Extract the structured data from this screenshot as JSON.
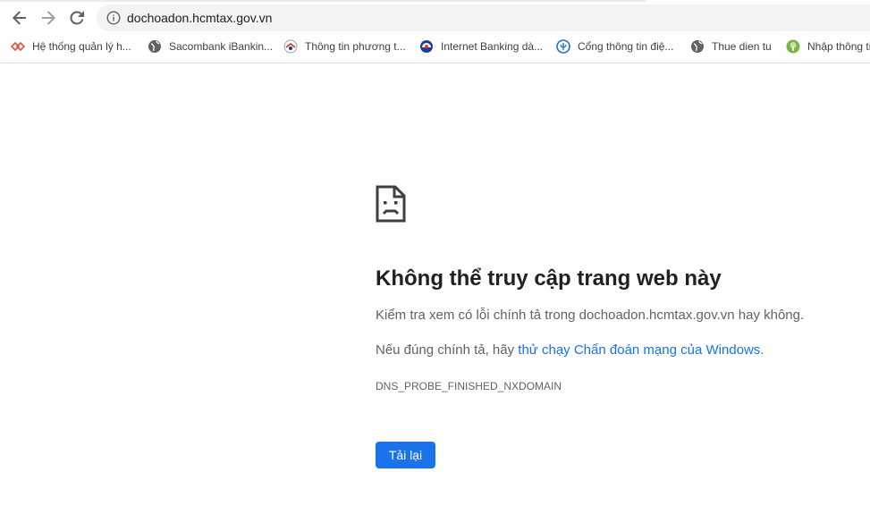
{
  "browser": {
    "url": "dochoadon.hcmtax.gov.vn",
    "bookmarks": [
      {
        "label": "Hệ thống quản lý h...",
        "icon": "red-diamond-logo-icon"
      },
      {
        "label": "Sacombank iBankin...",
        "icon": "globe-icon"
      },
      {
        "label": "Thông tin phương t...",
        "icon": "site-logo-icon"
      },
      {
        "label": "Internet Banking dà...",
        "icon": "bank-logo-icon"
      },
      {
        "label": "Cổng thông tin điệ...",
        "icon": "portal-logo-icon"
      },
      {
        "label": "Thue dien tu",
        "icon": "globe-icon"
      },
      {
        "label": "Nhập thông tin",
        "icon": "tree-logo-icon"
      }
    ]
  },
  "error": {
    "title": "Không thể truy cập trang web này",
    "line1": "Kiểm tra xem có lỗi chính tả trong dochoadon.hcmtax.gov.vn hay không.",
    "line2_prefix": "Nếu đúng chính tả, hãy ",
    "line2_link": "thử chạy Chẩn đoán mạng của Windows",
    "line2_suffix": ".",
    "code": "DNS_PROBE_FINISHED_NXDOMAIN",
    "reload_label": "Tải lại"
  },
  "colors": {
    "accent": "#1a73e8",
    "title": "#202124",
    "body_text": "#5f6368"
  }
}
